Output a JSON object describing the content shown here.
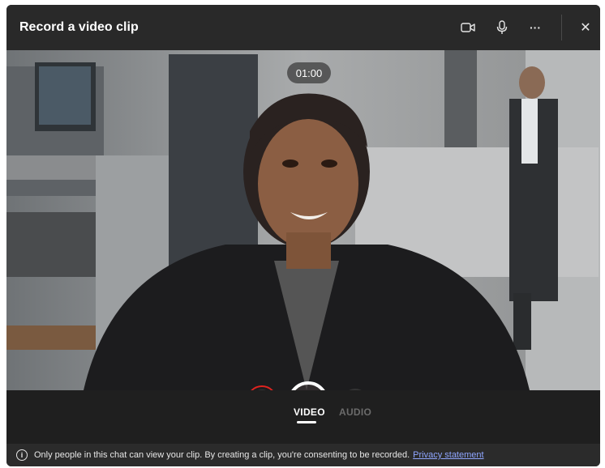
{
  "window": {
    "title": "Record a video clip",
    "toolbar": {
      "camera_icon": "video-camera-icon",
      "mic_icon": "microphone-icon",
      "more_icon": "more-options-icon",
      "more_glyph": "···",
      "close_icon": "close-icon",
      "close_glyph": "✕"
    }
  },
  "preview": {
    "timer": "01:00",
    "controls": {
      "upload_icon": "upload-icon",
      "record_button": "record-button",
      "effects_icon": "background-effects-icon"
    }
  },
  "modes": {
    "video_label": "VIDEO",
    "audio_label": "AUDIO",
    "selected": "VIDEO"
  },
  "footer": {
    "message": "Only people in this chat can view your clip. By creating a clip, you're consenting to be recorded.",
    "link": "Privacy statement"
  },
  "colors": {
    "background": "#1f1f1f",
    "titlebar": "#292929",
    "highlight": "#e0231f",
    "link": "#8fa6ff"
  }
}
